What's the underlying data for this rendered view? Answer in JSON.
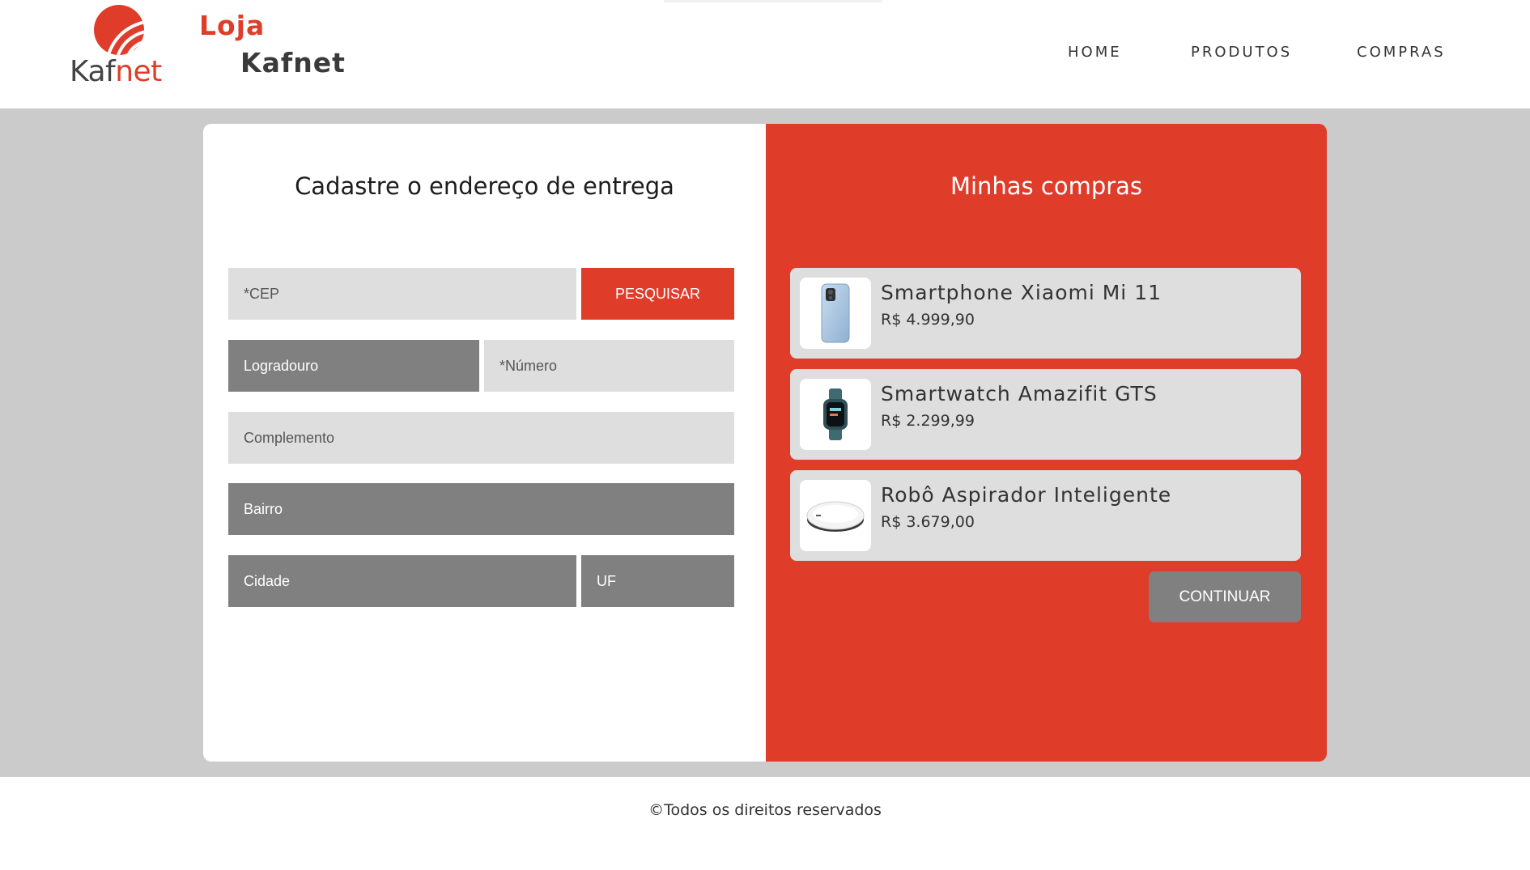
{
  "header": {
    "logo_word_1": "Kaf",
    "logo_word_2": "net",
    "brand_line1": "Loja",
    "brand_line2": "Kafnet",
    "nav": [
      "HOME",
      "PRODUTOS",
      "COMPRAS"
    ]
  },
  "address_form": {
    "title": "Cadastre o endereço de entrega",
    "cep_placeholder": "*CEP",
    "search_label": "PESQUISAR",
    "logradouro": "Logradouro",
    "numero_placeholder": "*Número",
    "complemento_placeholder": "Complemento",
    "bairro": "Bairro",
    "cidade": "Cidade",
    "uf": "UF"
  },
  "cart": {
    "title": "Minhas compras",
    "items": [
      {
        "name": "Smartphone Xiaomi Mi 11",
        "price": "R$ 4.999,90",
        "icon": "smartphone-icon"
      },
      {
        "name": "Smartwatch Amazifit GTS",
        "price": "R$ 2.299,99",
        "icon": "smartwatch-icon"
      },
      {
        "name": "Robô Aspirador Inteligente",
        "price": "R$ 3.679,00",
        "icon": "robot-vacuum-icon"
      }
    ],
    "continue_label": "CONTINUAR"
  },
  "footer": {
    "text": "©Todos os direitos reservados"
  },
  "colors": {
    "accent": "#e03c2a",
    "field_light": "#dedede",
    "field_dark": "#808080",
    "band": "#cbcbcb"
  }
}
